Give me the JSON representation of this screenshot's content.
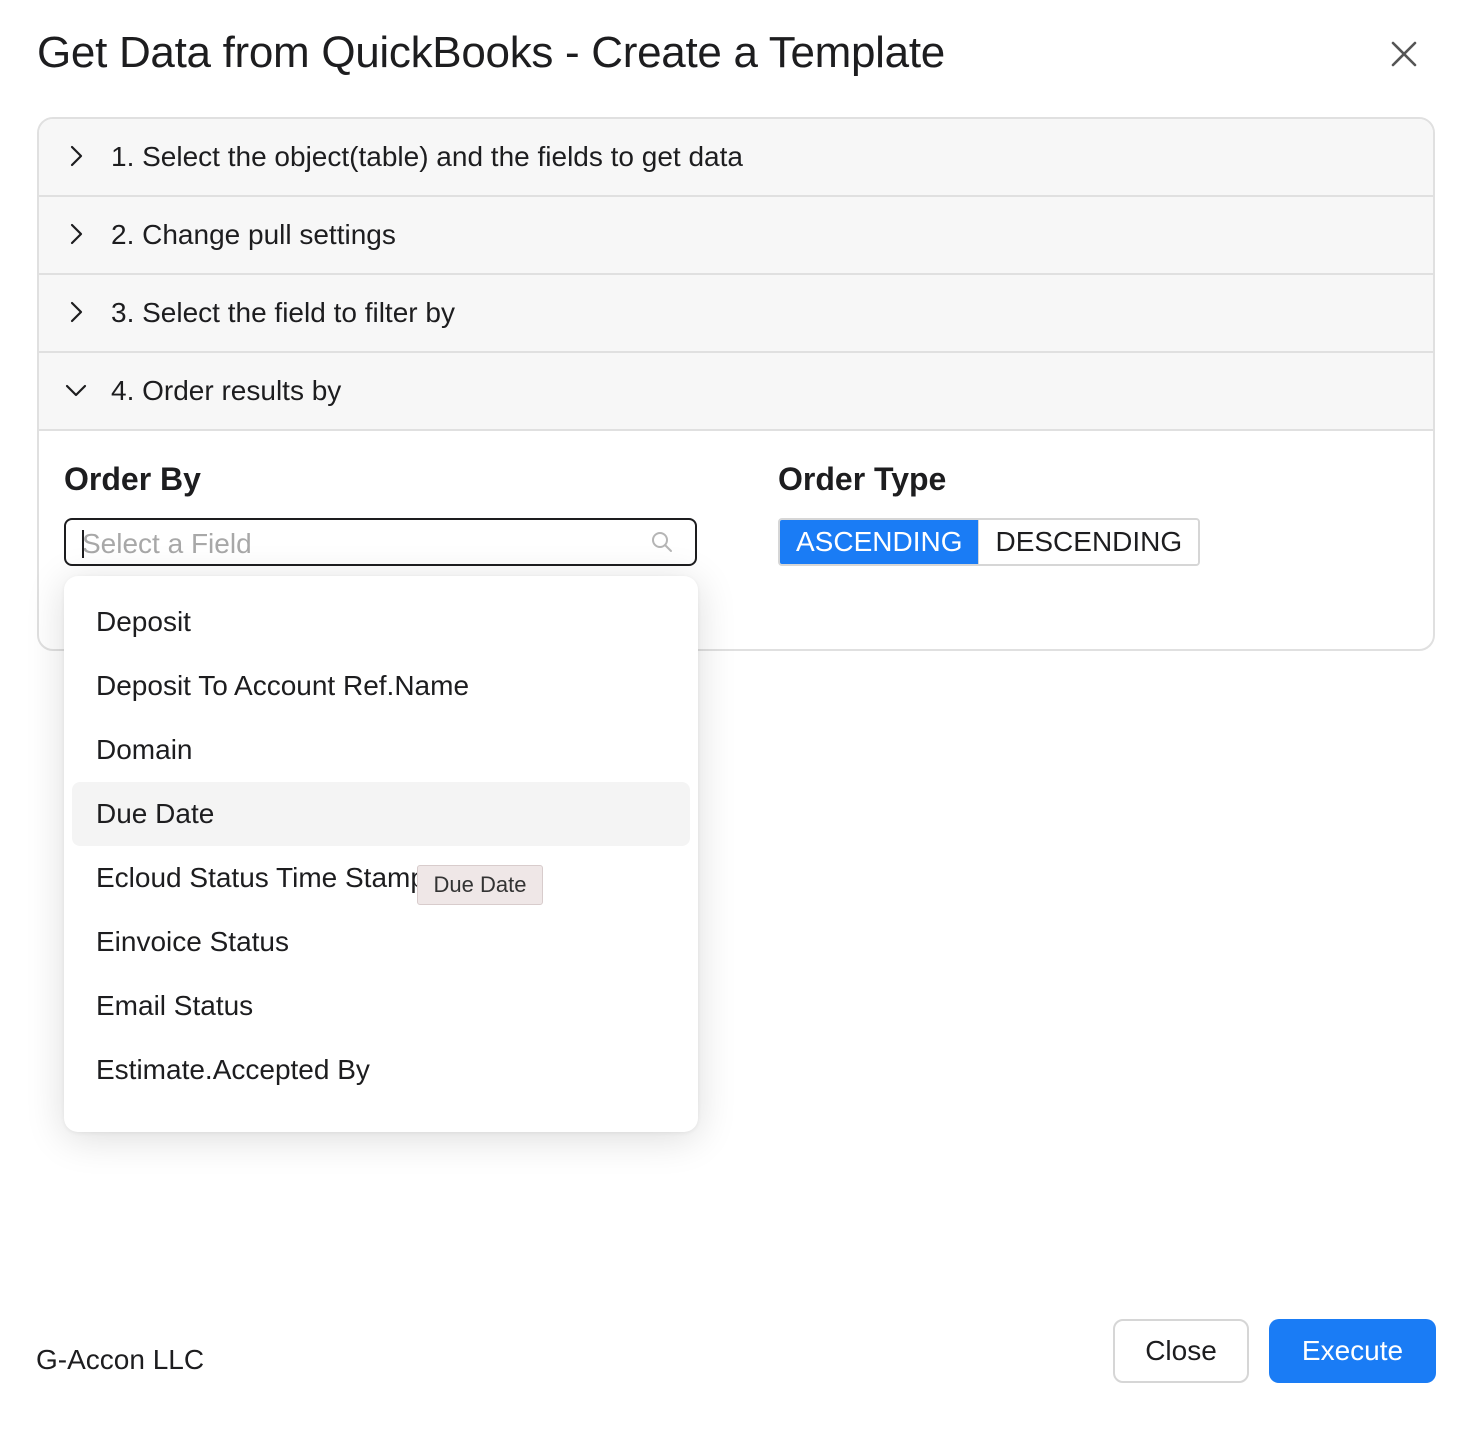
{
  "dialog": {
    "title": "Get Data from QuickBooks - Create a Template",
    "close_icon": "close-icon"
  },
  "accordion": {
    "sections": [
      {
        "label": "1. Select the object(table) and the fields to get data",
        "expanded": false
      },
      {
        "label": "2. Change pull settings",
        "expanded": false
      },
      {
        "label": "3. Select the field to filter by",
        "expanded": false
      },
      {
        "label": "4. Order results by",
        "expanded": true
      }
    ]
  },
  "order": {
    "order_by_label": "Order By",
    "order_type_label": "Order Type",
    "field_placeholder": "Select a Field",
    "field_value": "",
    "search_icon": "search-icon",
    "types": [
      {
        "label": "ASCENDING",
        "selected": true
      },
      {
        "label": "DESCENDING",
        "selected": false
      }
    ]
  },
  "dropdown": {
    "items": [
      "Deposit",
      "Deposit To Account Ref.Name",
      "Domain",
      "Due Date",
      "Ecloud Status Time Stamp",
      "Einvoice Status",
      "Email Status",
      "Estimate.Accepted By"
    ],
    "hovered_item": "Due Date",
    "tooltip": "Due Date"
  },
  "footer": {
    "company": "G-Accon LLC",
    "close_label": "Close",
    "execute_label": "Execute"
  },
  "colors": {
    "accent": "#1a7cf5",
    "header_bg": "#f7f7f7",
    "border": "#e0e0e0"
  }
}
